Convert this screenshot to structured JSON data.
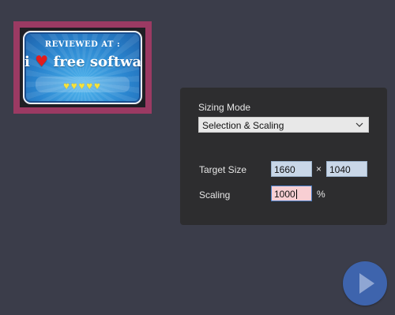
{
  "preview": {
    "badge_top": "REVIEWED AT :",
    "badge_word_i": "i",
    "badge_word_rest": "free software",
    "heart_icon": "heart-icon",
    "rating_hearts": "♥♥♥♥♥",
    "selection_color": "#9b3a63"
  },
  "panel": {
    "sizing_mode_label": "Sizing Mode",
    "sizing_mode_value": "Selection & Scaling",
    "target_size_label": "Target Size",
    "target_width": "1660",
    "times_symbol": "×",
    "target_height": "1040",
    "scaling_label": "Scaling",
    "scaling_value": "1000",
    "percent_symbol": "%"
  },
  "actions": {
    "play_icon": "play-icon",
    "accent_color": "#3e64ad"
  }
}
